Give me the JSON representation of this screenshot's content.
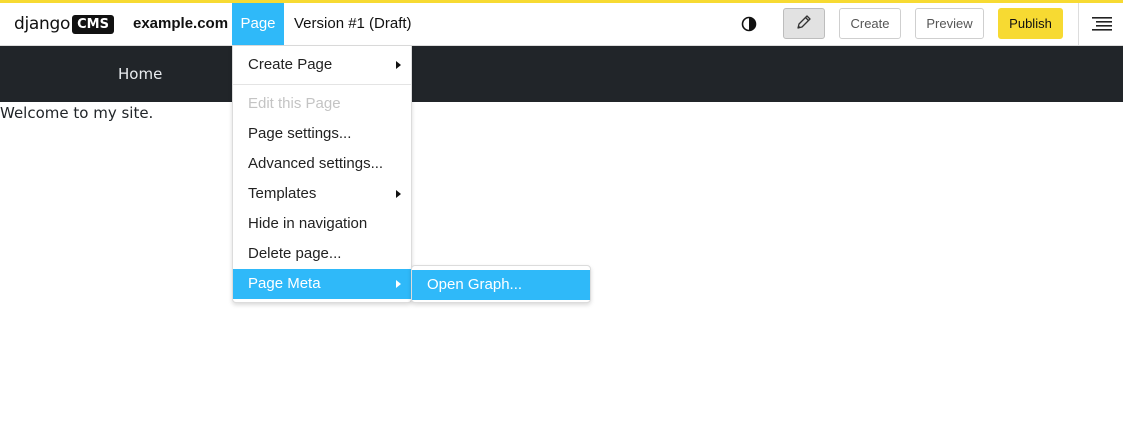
{
  "toolbar": {
    "logo_word": "django",
    "logo_box": "CMS",
    "site": "example.com",
    "page_menu": "Page",
    "version": "Version #1 (Draft)",
    "create_label": "Create",
    "preview_label": "Preview",
    "publish_label": "Publish",
    "accent_color": "#f7da32",
    "highlight_color": "#2fb9f9",
    "icons": {
      "contrast": "contrast-icon",
      "edit": "pencil-icon",
      "structure": "structure-icon"
    }
  },
  "nav": {
    "home": "Home",
    "background_color": "#212529"
  },
  "content": {
    "welcome": "Welcome to my site."
  },
  "page_menu": {
    "items": [
      {
        "label": "Create Page",
        "has_submenu": true,
        "disabled": false,
        "active": false
      },
      {
        "label": "Edit this Page",
        "has_submenu": false,
        "disabled": true,
        "active": false
      },
      {
        "label": "Page settings...",
        "has_submenu": false,
        "disabled": false,
        "active": false
      },
      {
        "label": "Advanced settings...",
        "has_submenu": false,
        "disabled": false,
        "active": false
      },
      {
        "label": "Templates",
        "has_submenu": true,
        "disabled": false,
        "active": false
      },
      {
        "label": "Hide in navigation",
        "has_submenu": false,
        "disabled": false,
        "active": false
      },
      {
        "label": "Delete page...",
        "has_submenu": false,
        "disabled": false,
        "active": false
      },
      {
        "label": "Page Meta",
        "has_submenu": true,
        "disabled": false,
        "active": true
      }
    ],
    "submenu": {
      "items": [
        {
          "label": "Open Graph...",
          "active": true
        }
      ]
    }
  }
}
